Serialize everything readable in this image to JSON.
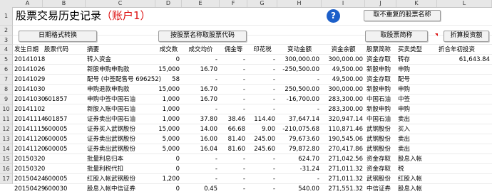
{
  "columns": [
    "A",
    "B",
    "C",
    "D",
    "E",
    "F",
    "G",
    "H",
    "I",
    "J",
    "K",
    "L"
  ],
  "rows": [
    "1",
    "2",
    "3",
    "4",
    "5",
    "6",
    "7",
    "8",
    "9",
    "10",
    "11",
    "12",
    "13",
    "14",
    "15",
    "16",
    "17"
  ],
  "title": "股票交易历史记录",
  "account": "（账户1）",
  "help_label": "?",
  "buttons": {
    "unique_names": "取不重复的股票名称",
    "date_format": "日期格式转换",
    "fetch_names": "按股票名称取股票代码",
    "by_short": "取股票简称",
    "calc_funds": "折算投资额"
  },
  "headers": [
    "发生日期",
    "股票代码",
    "摘要",
    "成交数",
    "成交均价",
    "佣金等",
    "印花税",
    "变动金额",
    "资金余额",
    "股票简称",
    "买卖类型",
    "折合年初投资"
  ],
  "records": [
    {
      "date": "20141018",
      "code": "",
      "memo": "转入资金",
      "qty": "0",
      "price": "-",
      "fee": "-",
      "tax": "-",
      "amount": "300,000.00",
      "balance": "300,000.00",
      "name": "资金存取",
      "type": "转存",
      "invest": "61,643.84"
    },
    {
      "date": "20141026",
      "code": "",
      "memo": "新股申购申购款",
      "qty": "15,000",
      "price": "16.70",
      "fee": "-",
      "tax": "-",
      "amount": "-250,500.00",
      "balance": "49,500.00",
      "name": "新股申购",
      "type": "申购",
      "invest": ""
    },
    {
      "date": "20141029",
      "code": "",
      "memo": "配号 (中签配售号 696252)",
      "qty": "58",
      "price": "-",
      "fee": "-",
      "tax": "-",
      "amount": "-",
      "balance": "49,500.00",
      "name": "资金存取",
      "type": "配号",
      "invest": ""
    },
    {
      "date": "20141030",
      "code": "",
      "memo": "申购退款申购款",
      "qty": "15,000",
      "price": "16.70",
      "fee": "-",
      "tax": "-",
      "amount": "250,500.00",
      "balance": "300,000.00",
      "name": "新股申购",
      "type": "申购",
      "invest": ""
    },
    {
      "date": "20141030",
      "code": "601857",
      "memo": "申购中签中国石油",
      "qty": "1,000",
      "price": "16.70",
      "fee": "-",
      "tax": "-",
      "amount": "-16,700.00",
      "balance": "283,300.00",
      "name": "中国石油",
      "type": "中签",
      "invest": ""
    },
    {
      "date": "20141102",
      "code": "",
      "memo": "新股入账中国石油",
      "qty": "1,000",
      "price": "-",
      "fee": "-",
      "tax": "-",
      "amount": "-",
      "balance": "283,300.00",
      "name": "新股申购",
      "type": "申购",
      "invest": ""
    },
    {
      "date": "20141114",
      "code": "601857",
      "memo": "证券卖出中国石油",
      "qty": "1,000",
      "price": "37.80",
      "fee": "38.46",
      "tax": "114.40",
      "amount": "37,647.14",
      "balance": "320,947.14",
      "name": "中国石油",
      "type": "卖出",
      "invest": ""
    },
    {
      "date": "20141115",
      "code": "600005",
      "memo": "证券买入武钢股份",
      "qty": "15,000",
      "price": "14.00",
      "fee": "66.68",
      "tax": "9.00",
      "amount": "-210,075.68",
      "balance": "110,871.46",
      "name": "武钢股份",
      "type": "买入",
      "invest": ""
    },
    {
      "date": "20141120",
      "code": "600005",
      "memo": "证券卖出武钢股份",
      "qty": "5,000",
      "price": "16.00",
      "fee": "81.40",
      "tax": "245.00",
      "amount": "79,673.60",
      "balance": "190,545.06",
      "name": "武钢股份",
      "type": "卖出",
      "invest": ""
    },
    {
      "date": "20141120",
      "code": "600005",
      "memo": "证券卖出武钢股份",
      "qty": "5,000",
      "price": "16.04",
      "fee": "81.60",
      "tax": "245.60",
      "amount": "79,872.80",
      "balance": "270,417.86",
      "name": "武钢股份",
      "type": "卖出",
      "invest": ""
    },
    {
      "date": "20150320",
      "code": "",
      "memo": "批量利息归本",
      "qty": "0",
      "price": "-",
      "fee": "-",
      "tax": "-",
      "amount": "624.70",
      "balance": "271,042.56",
      "name": "资金存取",
      "type": "股息入帐",
      "invest": ""
    },
    {
      "date": "20150320",
      "code": "",
      "memo": "批量利税代扣",
      "qty": "0",
      "price": "-",
      "fee": "-",
      "tax": "-",
      "amount": "-31.24",
      "balance": "271,011.32",
      "name": "资金存取",
      "type": "税",
      "invest": ""
    },
    {
      "date": "20150424",
      "code": "600005",
      "memo": "红股入帐武钢股份",
      "qty": "1,200",
      "price": "-",
      "fee": "-",
      "tax": "-",
      "amount": "-",
      "balance": "271,011.32",
      "name": "武钢股份",
      "type": "红股入帐",
      "invest": ""
    },
    {
      "date": "20150429",
      "code": "600030",
      "memo": "股息入帐中信证券",
      "qty": "0",
      "price": "0.45",
      "fee": "-",
      "tax": "-",
      "amount": "540.00",
      "balance": "271,551.32",
      "name": "中信证券",
      "type": "股息入帐",
      "invest": ""
    }
  ]
}
